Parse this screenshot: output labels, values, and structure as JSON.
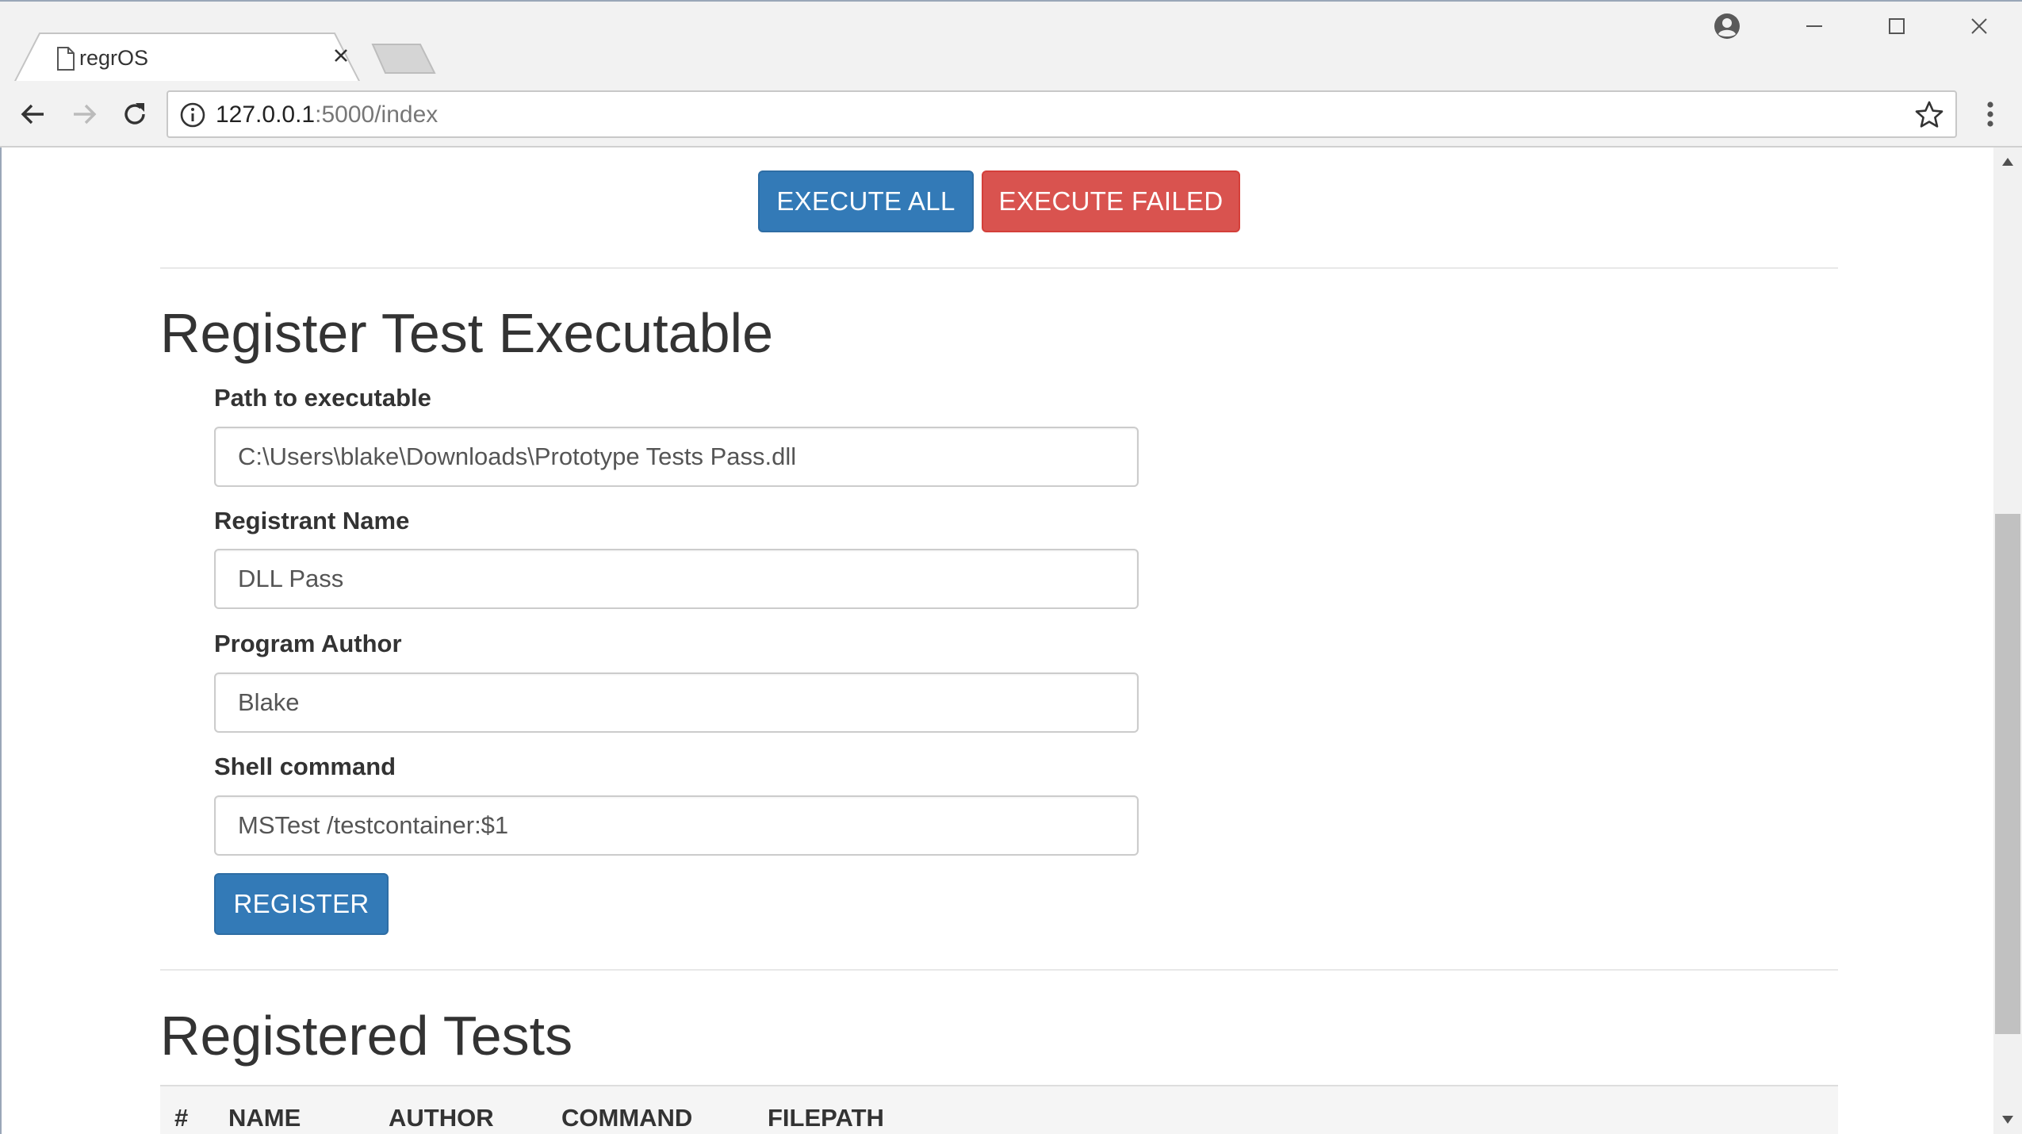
{
  "browser": {
    "tab_title": "regrOS",
    "url_host": "127.0.0.1",
    "url_path": ":5000/index"
  },
  "actions": {
    "execute_all_label": "EXECUTE ALL",
    "execute_failed_label": "EXECUTE FAILED"
  },
  "register": {
    "heading": "Register Test Executable",
    "fields": [
      {
        "label": "Path to executable",
        "value": "C:\\Users\\blake\\Downloads\\Prototype Tests Pass.dll"
      },
      {
        "label": "Registrant Name",
        "value": "DLL Pass"
      },
      {
        "label": "Program Author",
        "value": "Blake"
      },
      {
        "label": "Shell command",
        "value": "MSTest /testcontainer:$1"
      }
    ],
    "submit_label": "REGISTER"
  },
  "registered": {
    "heading": "Registered Tests",
    "columns": [
      "#",
      "NAME",
      "AUTHOR",
      "COMMAND",
      "FILEPATH"
    ]
  },
  "colors": {
    "primary": "#337ab7",
    "danger": "#d9534f",
    "text": "#333333"
  },
  "icons": {
    "tab": "file-icon",
    "tab_close": "close-icon",
    "profile": "account-circle-icon",
    "back": "arrow-left-icon",
    "forward": "arrow-right-icon",
    "reload": "reload-icon",
    "site_info": "info-icon",
    "bookmark": "star-icon",
    "menu": "kebab-menu-icon"
  }
}
